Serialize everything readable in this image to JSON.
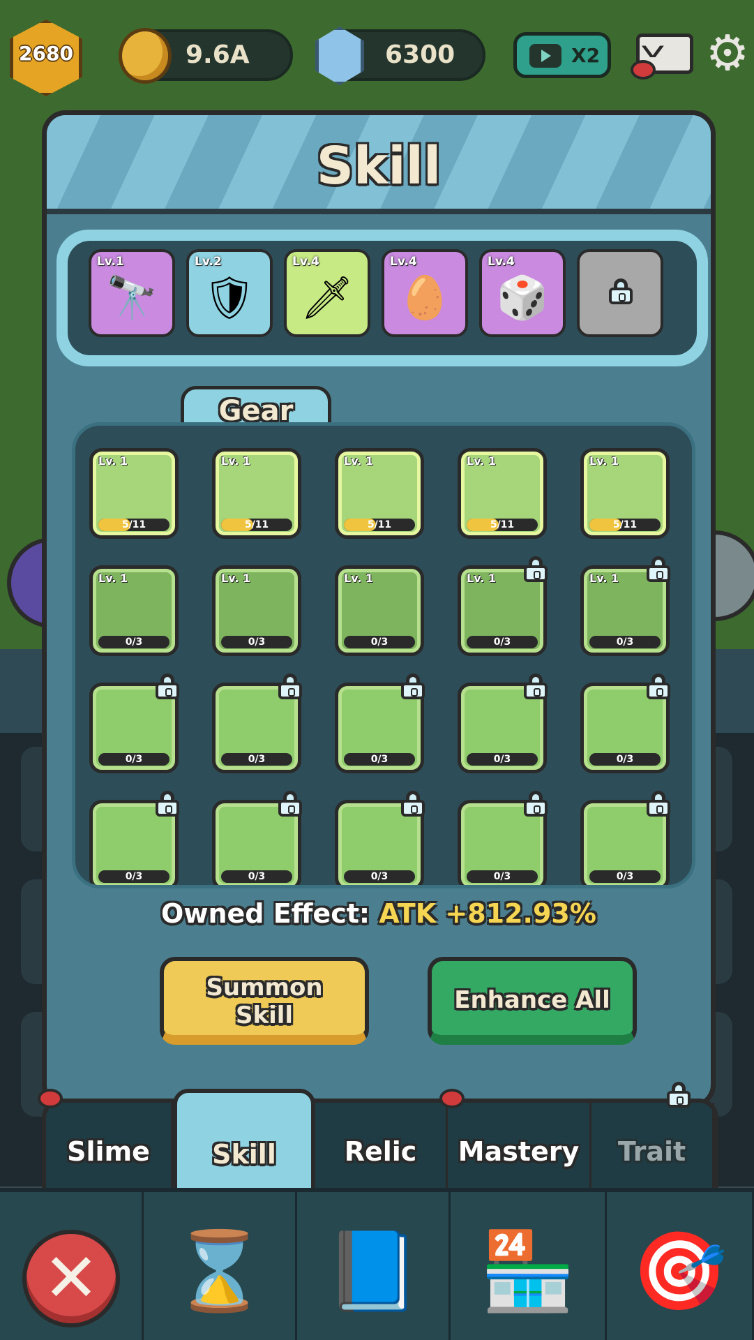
{
  "topbar": {
    "level": "2680",
    "gold": "9.6A",
    "gems": "6300",
    "speed_boost": "X2"
  },
  "panel": {
    "title": "Skill",
    "equipped": [
      {
        "level": "Lv.1",
        "icon": "cannon-icon",
        "glyph": "🔭",
        "color": "#c98ae0"
      },
      {
        "level": "Lv.2",
        "icon": "shield-icon",
        "glyph": "🛡",
        "color": "#8fd3e3"
      },
      {
        "level": "Lv.4",
        "icon": "sword-icon",
        "glyph": "🗡",
        "color": "#c7ea84"
      },
      {
        "level": "Lv.4",
        "icon": "egg-icon",
        "glyph": "🥚",
        "color": "#c98ae0"
      },
      {
        "level": "Lv.4",
        "icon": "dice-icon",
        "glyph": "🎲",
        "color": "#c98ae0"
      },
      {
        "level": "",
        "icon": "lock-icon",
        "glyph": "",
        "color": "#a8a8a8"
      }
    ],
    "section_tab": "Gear",
    "cards": [
      {
        "level": "Lv. 1",
        "count": "5/11",
        "fill": 0.45,
        "state": "active",
        "locked": false
      },
      {
        "level": "Lv. 1",
        "count": "5/11",
        "fill": 0.45,
        "state": "active",
        "locked": false
      },
      {
        "level": "Lv. 1",
        "count": "5/11",
        "fill": 0.45,
        "state": "active",
        "locked": false
      },
      {
        "level": "Lv. 1",
        "count": "5/11",
        "fill": 0.45,
        "state": "active",
        "locked": false
      },
      {
        "level": "Lv. 1",
        "count": "5/11",
        "fill": 0.45,
        "state": "active",
        "locked": false
      },
      {
        "level": "Lv. 1",
        "count": "0/3",
        "fill": 0,
        "state": "idle",
        "locked": false
      },
      {
        "level": "Lv. 1",
        "count": "0/3",
        "fill": 0,
        "state": "idle",
        "locked": false
      },
      {
        "level": "Lv. 1",
        "count": "0/3",
        "fill": 0,
        "state": "idle",
        "locked": false
      },
      {
        "level": "Lv. 1",
        "count": "0/3",
        "fill": 0,
        "state": "idle",
        "locked": true
      },
      {
        "level": "Lv. 1",
        "count": "0/3",
        "fill": 0,
        "state": "idle",
        "locked": true
      },
      {
        "level": "",
        "count": "0/3",
        "fill": 0,
        "state": "locked",
        "locked": true
      },
      {
        "level": "",
        "count": "0/3",
        "fill": 0,
        "state": "locked",
        "locked": true
      },
      {
        "level": "",
        "count": "0/3",
        "fill": 0,
        "state": "locked",
        "locked": true
      },
      {
        "level": "",
        "count": "0/3",
        "fill": 0,
        "state": "locked",
        "locked": true
      },
      {
        "level": "",
        "count": "0/3",
        "fill": 0,
        "state": "locked",
        "locked": true
      },
      {
        "level": "",
        "count": "0/3",
        "fill": 0,
        "state": "locked",
        "locked": true
      },
      {
        "level": "",
        "count": "0/3",
        "fill": 0,
        "state": "locked",
        "locked": true
      },
      {
        "level": "",
        "count": "0/3",
        "fill": 0,
        "state": "locked",
        "locked": true
      },
      {
        "level": "",
        "count": "0/3",
        "fill": 0,
        "state": "locked",
        "locked": true
      },
      {
        "level": "",
        "count": "0/3",
        "fill": 0,
        "state": "locked",
        "locked": true
      }
    ],
    "owned_effect_label": "Owned Effect:",
    "owned_effect_value": "ATK +812.93%",
    "summon_label_1": "Summon",
    "summon_label_2": "Skill",
    "enhance_label": "Enhance All"
  },
  "tabs": [
    {
      "label": "Slime",
      "selected": false,
      "dot": true,
      "locked": false
    },
    {
      "label": "Skill",
      "selected": true,
      "dot": false,
      "locked": false
    },
    {
      "label": "Relic",
      "selected": false,
      "dot": false,
      "locked": false
    },
    {
      "label": "Mastery",
      "selected": false,
      "dot": true,
      "locked": false
    },
    {
      "label": "Trait",
      "selected": false,
      "dot": false,
      "locked": true
    }
  ],
  "nav": [
    {
      "icon": "close-icon"
    },
    {
      "icon": "hourglass-icon",
      "glyph": "⌛"
    },
    {
      "icon": "book-icon",
      "glyph": "📘"
    },
    {
      "icon": "shop-icon",
      "glyph": "🏪"
    },
    {
      "icon": "target-icon",
      "glyph": "🎯"
    }
  ]
}
